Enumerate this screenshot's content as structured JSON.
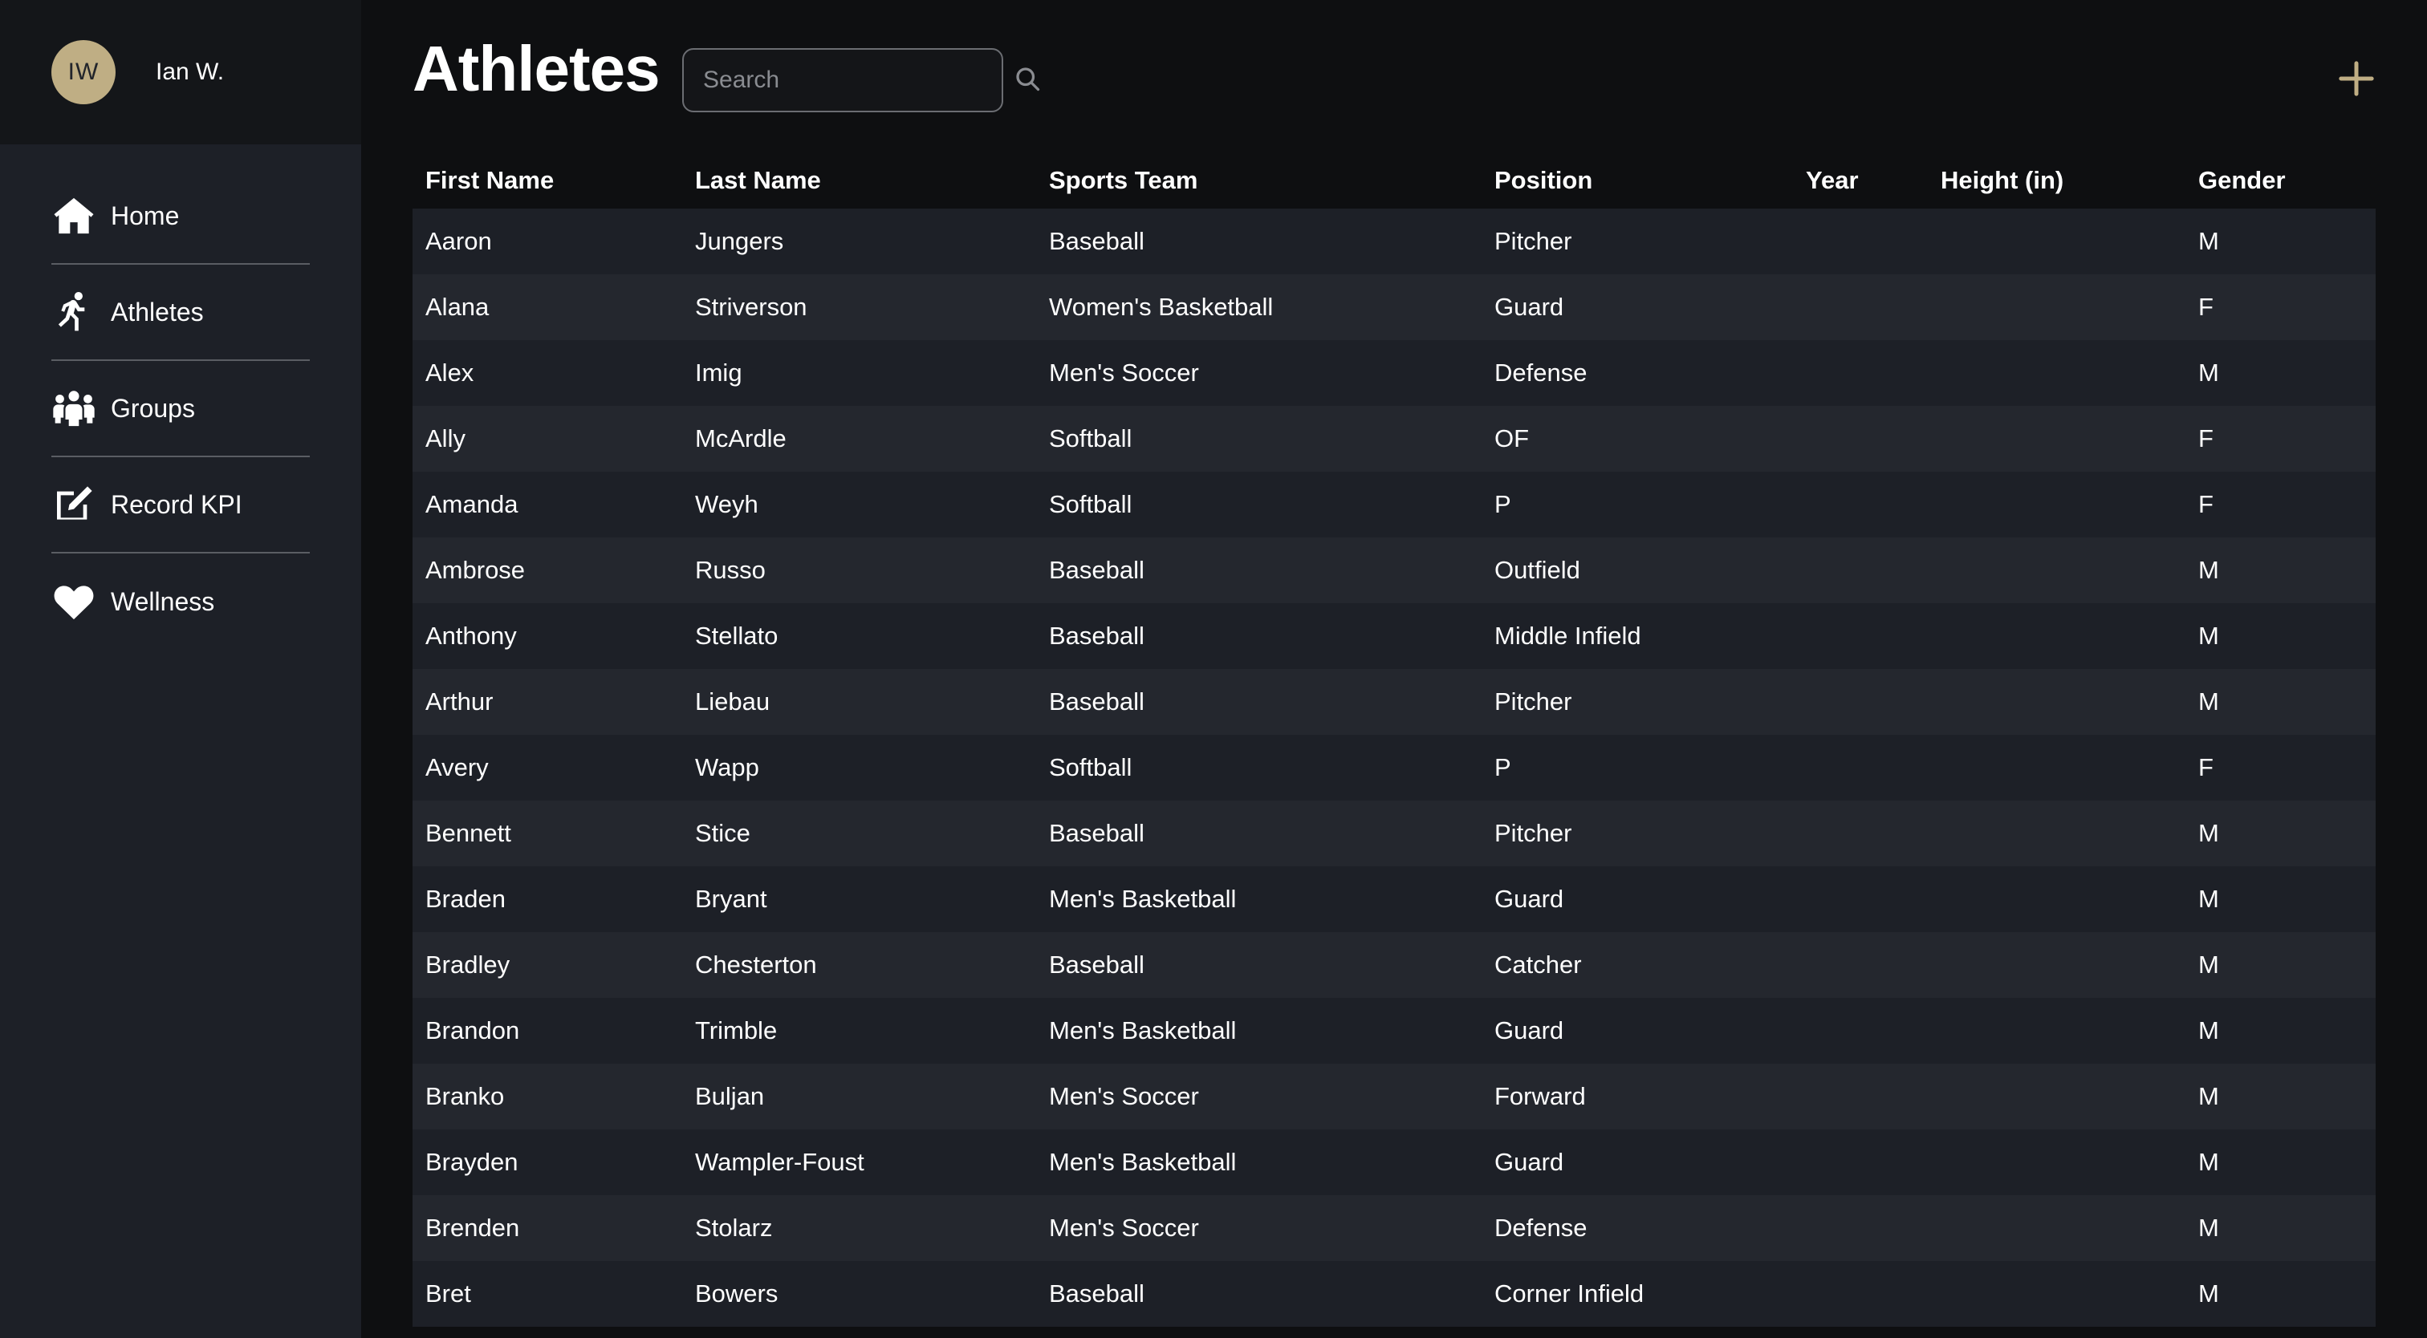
{
  "user": {
    "initials": "IW",
    "name": "Ian W."
  },
  "nav": [
    {
      "label": "Home",
      "icon": "home-icon"
    },
    {
      "label": "Athletes",
      "icon": "running-person-icon"
    },
    {
      "label": "Groups",
      "icon": "people-group-icon"
    },
    {
      "label": "Record KPI",
      "icon": "edit-icon"
    },
    {
      "label": "Wellness",
      "icon": "heart-icon"
    }
  ],
  "page": {
    "title": "Athletes"
  },
  "search": {
    "placeholder": "Search",
    "value": ""
  },
  "colors": {
    "accent": "#bfae84",
    "sidebar": "#1d2027",
    "background": "#0e0f11"
  },
  "table": {
    "columns": [
      "First Name",
      "Last Name",
      "Sports Team",
      "Position",
      "Year",
      "Height (in)",
      "Gender"
    ],
    "rows": [
      [
        "Aaron",
        "Jungers",
        "Baseball",
        "Pitcher",
        "",
        "",
        "M"
      ],
      [
        "Alana",
        "Striverson",
        "Women's Basketball",
        "Guard",
        "",
        "",
        "F"
      ],
      [
        "Alex",
        "Imig",
        "Men's Soccer",
        "Defense",
        "",
        "",
        "M"
      ],
      [
        "Ally",
        "McArdle",
        "Softball",
        "OF",
        "",
        "",
        "F"
      ],
      [
        "Amanda",
        "Weyh",
        "Softball",
        "P",
        "",
        "",
        "F"
      ],
      [
        "Ambrose",
        "Russo",
        "Baseball",
        "Outfield",
        "",
        "",
        "M"
      ],
      [
        "Anthony",
        "Stellato",
        "Baseball",
        "Middle Infield",
        "",
        "",
        "M"
      ],
      [
        "Arthur",
        "Liebau",
        "Baseball",
        "Pitcher",
        "",
        "",
        "M"
      ],
      [
        "Avery",
        "Wapp",
        "Softball",
        "P",
        "",
        "",
        "F"
      ],
      [
        "Bennett",
        "Stice",
        "Baseball",
        "Pitcher",
        "",
        "",
        "M"
      ],
      [
        "Braden",
        "Bryant",
        "Men's Basketball",
        "Guard",
        "",
        "",
        "M"
      ],
      [
        "Bradley",
        "Chesterton",
        "Baseball",
        "Catcher",
        "",
        "",
        "M"
      ],
      [
        "Brandon",
        "Trimble",
        "Men's Basketball",
        "Guard",
        "",
        "",
        "M"
      ],
      [
        "Branko",
        "Buljan",
        "Men's Soccer",
        "Forward",
        "",
        "",
        "M"
      ],
      [
        "Brayden",
        "Wampler-Foust",
        "Men's Basketball",
        "Guard",
        "",
        "",
        "M"
      ],
      [
        "Brenden",
        "Stolarz",
        "Men's Soccer",
        "Defense",
        "",
        "",
        "M"
      ],
      [
        "Bret",
        "Bowers",
        "Baseball",
        "Corner Infield",
        "",
        "",
        "M"
      ]
    ]
  }
}
